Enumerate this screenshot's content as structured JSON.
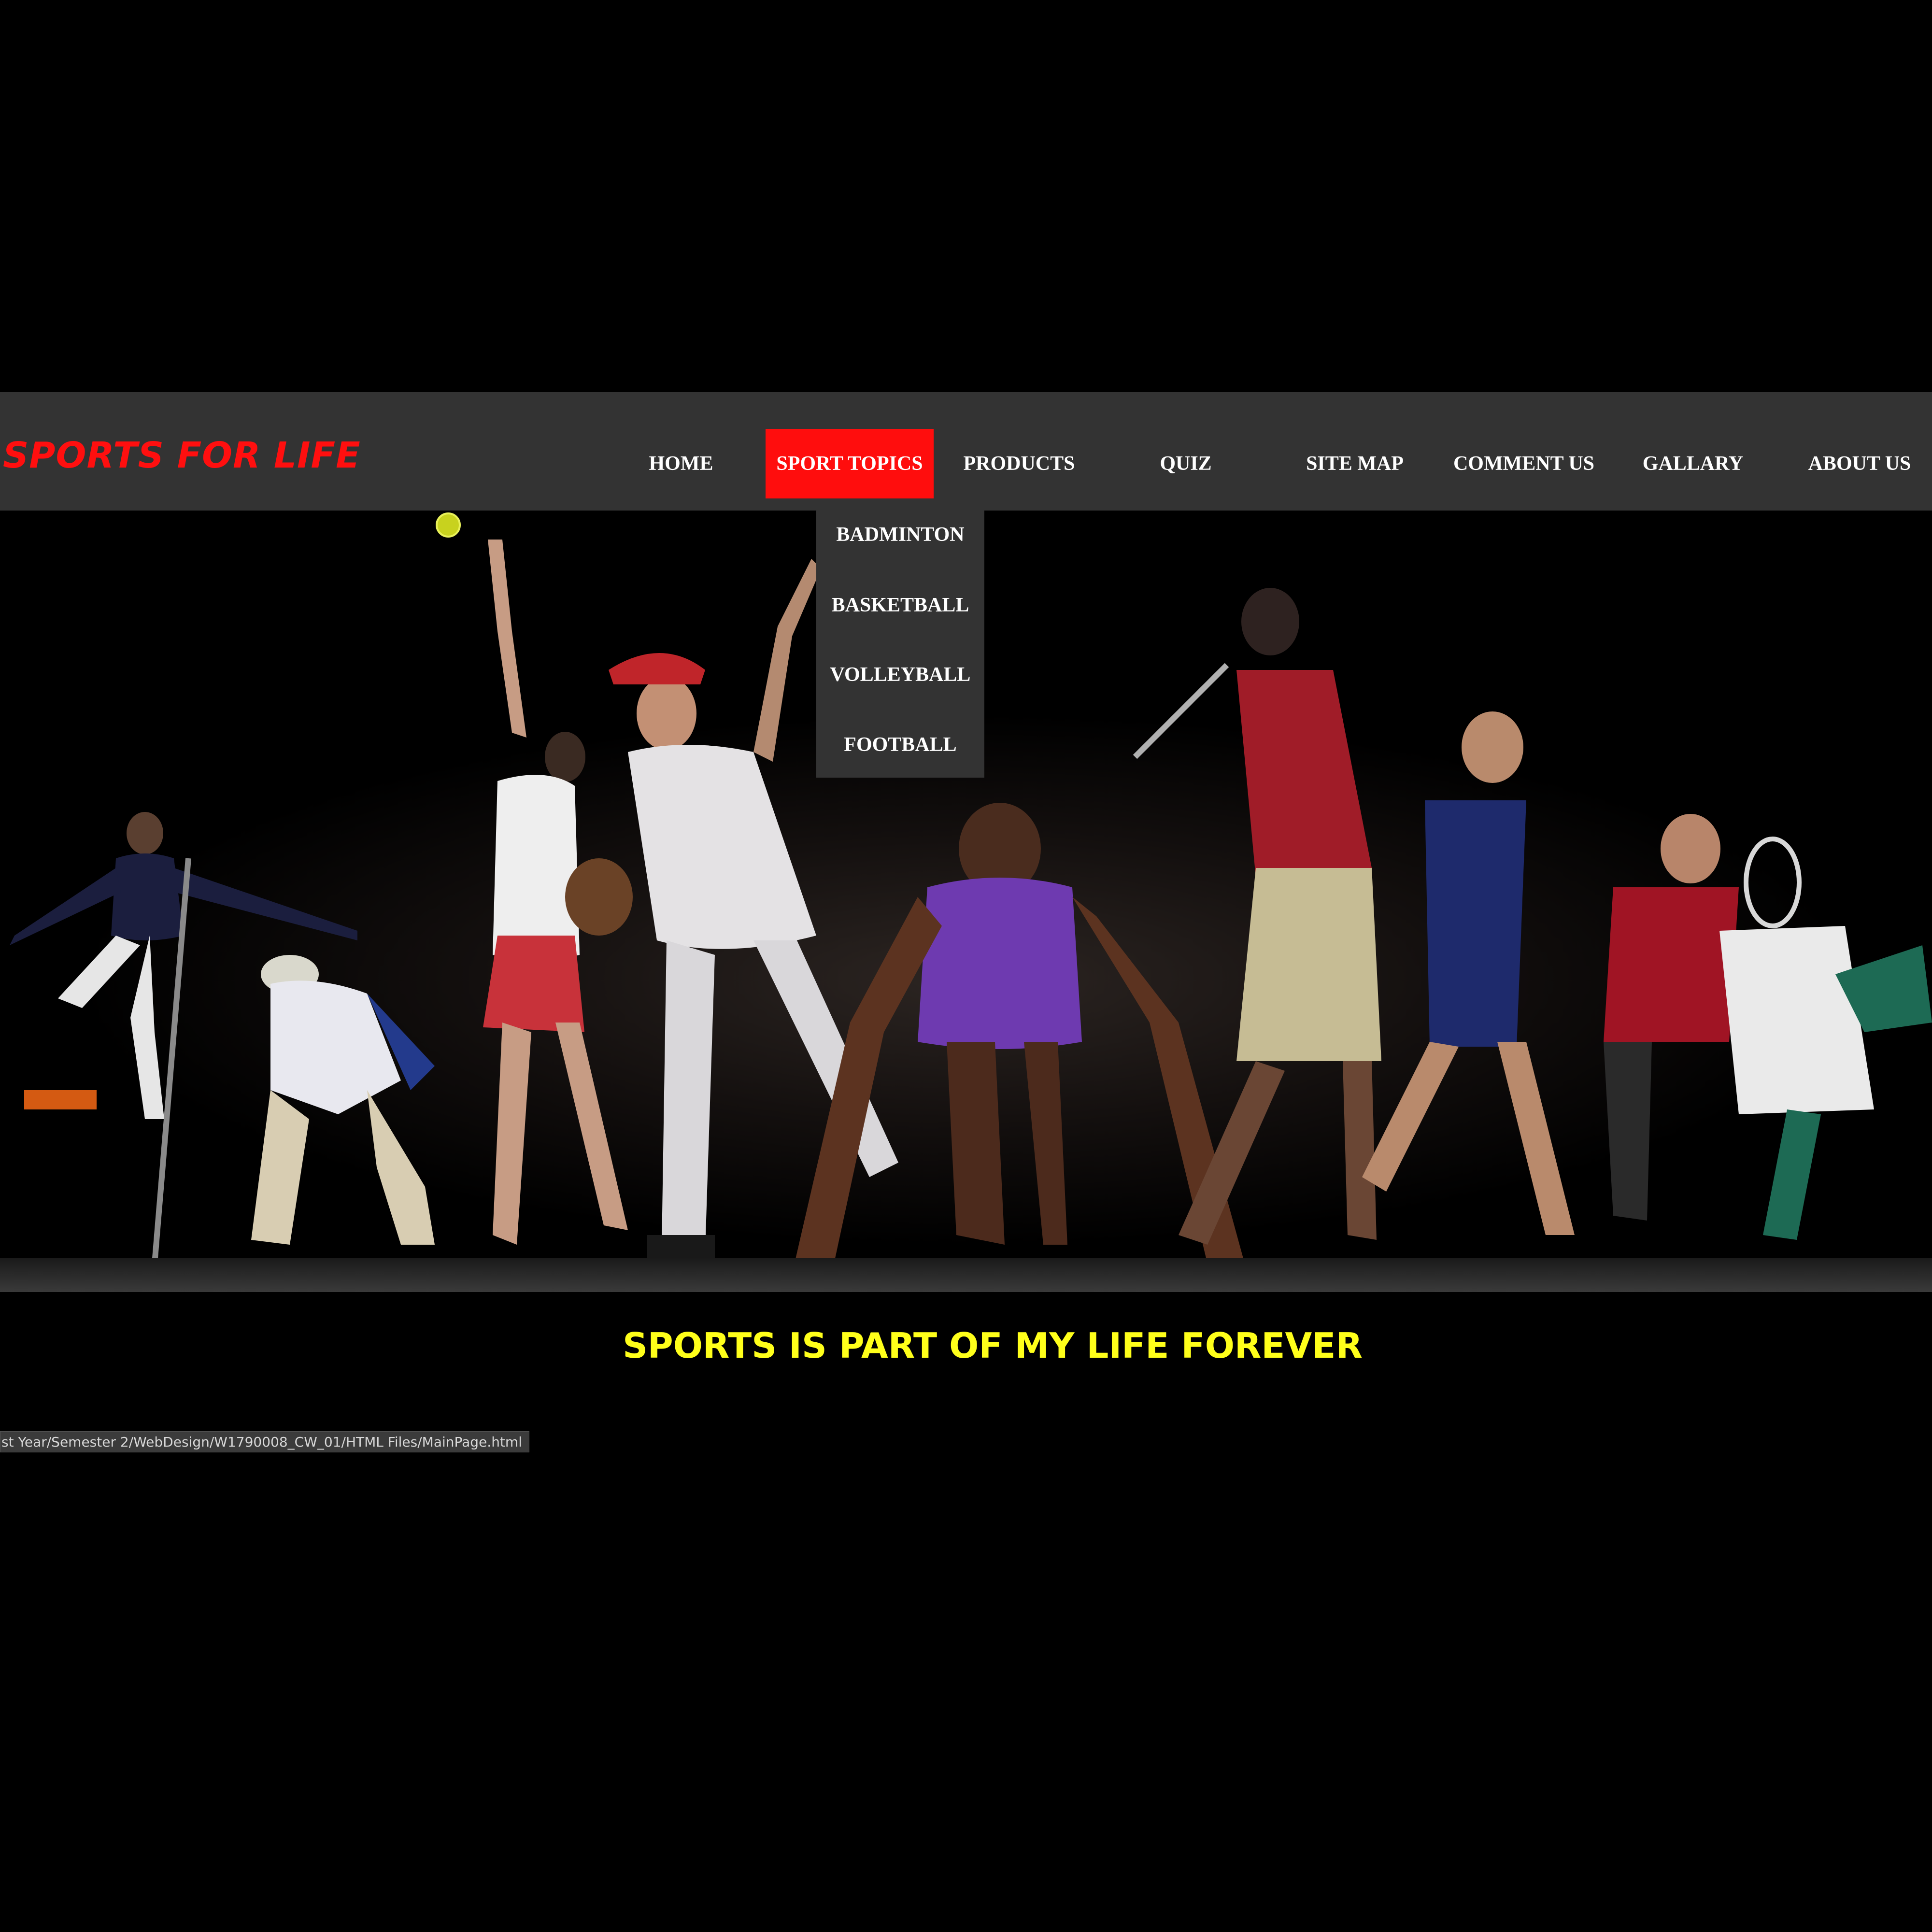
{
  "site": {
    "brand": "SPORTS FOR LIFE"
  },
  "nav": {
    "items": [
      {
        "label": "HOME"
      },
      {
        "label": "SPORT TOPICS",
        "active": true
      },
      {
        "label": "PRODUCTS"
      },
      {
        "label": "QUIZ"
      },
      {
        "label": "SITE MAP"
      },
      {
        "label": "COMMENT US"
      },
      {
        "label": "GALLARY"
      },
      {
        "label": "ABOUT US"
      }
    ],
    "dropdown": [
      "BADMINTON",
      "BASKETBALL",
      "VOLLEYBALL",
      "FOOTBALL"
    ]
  },
  "hero": {
    "image": "athletes-collage"
  },
  "tagline": "SPORTS IS PART OF MY LIFE FOREVER",
  "status_bar": {
    "url": "st Year/Semester 2/WebDesign/W1790008_CW_01/HTML Files/MainPage.html"
  },
  "colors": {
    "background": "#000000",
    "navbar": "#333333",
    "brand": "#ff0f0f",
    "active_tab": "#ff0d0d",
    "tagline": "#ffff1a"
  }
}
